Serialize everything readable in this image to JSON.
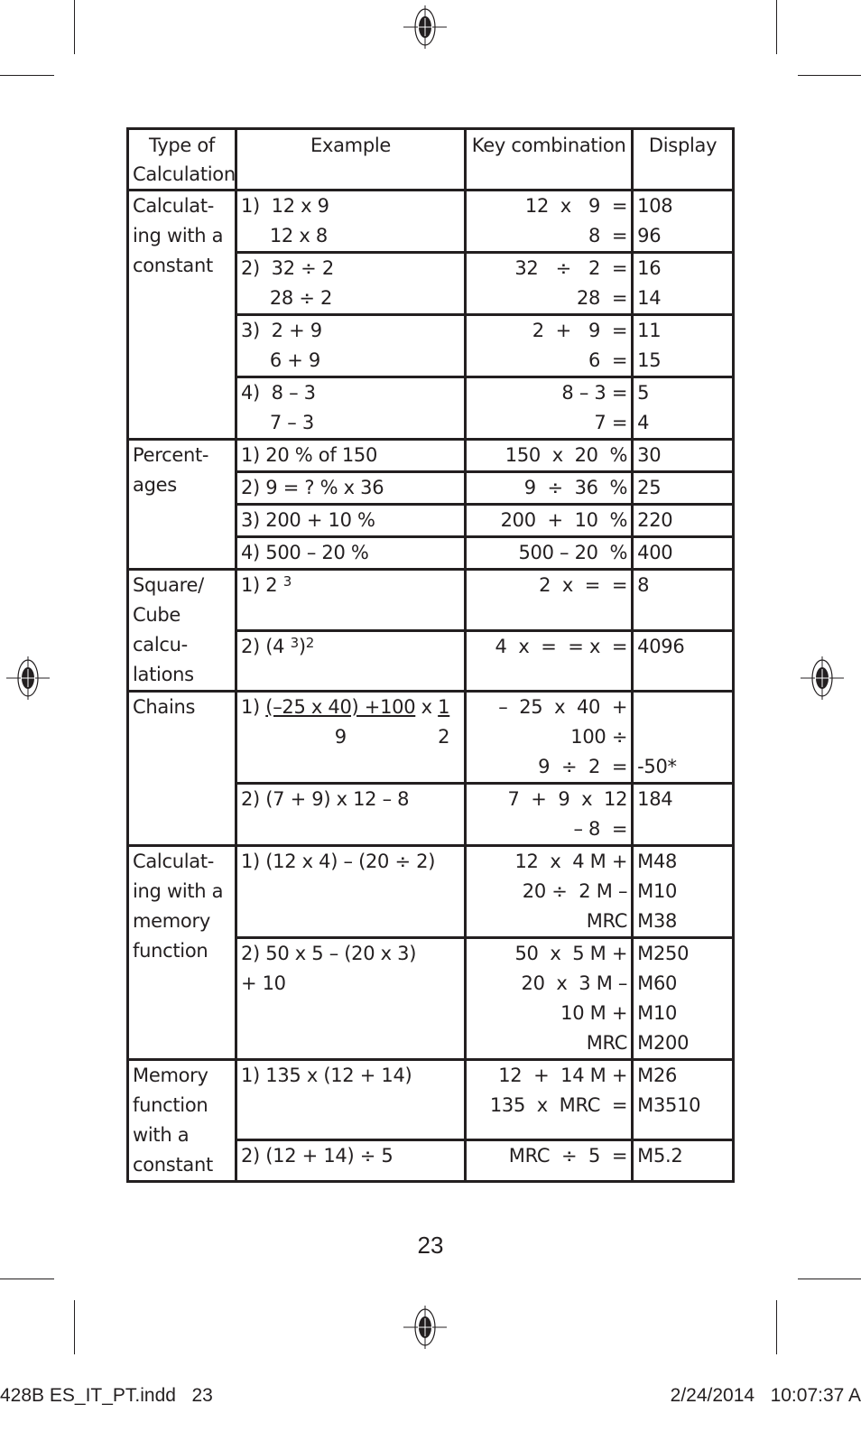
{
  "table": {
    "headers": {
      "type": "Type of Calculation",
      "example": "Example",
      "keys": "Key combination",
      "display": "Display"
    },
    "groups": [
      {
        "type": "Calculat-\ning with a\nconstant",
        "rows": [
          {
            "example": [
              "1)  12 x 9",
              "     12 x 8"
            ],
            "keys": [
              "12  x   9  =",
              "8  ="
            ],
            "display": [
              "108",
              "96"
            ]
          },
          {
            "example": [
              "2)  32 ÷ 2",
              "     28 ÷ 2"
            ],
            "keys": [
              "32   ÷   2  =",
              "28  ="
            ],
            "display": [
              "16",
              "14"
            ]
          },
          {
            "example": [
              "3)  2 + 9",
              "     6 + 9"
            ],
            "keys": [
              "2  +   9  =",
              "6  ="
            ],
            "display": [
              "11",
              "15"
            ]
          },
          {
            "example": [
              "4)  8 – 3",
              "     7 – 3"
            ],
            "keys": [
              "8 – 3 =",
              "7 ="
            ],
            "display": [
              "5",
              "4"
            ]
          }
        ]
      },
      {
        "type": "Percent-\nages",
        "rows": [
          {
            "example": [
              "1) 20 % of 150"
            ],
            "keys": [
              "150  x  20  %"
            ],
            "display": [
              "30"
            ]
          },
          {
            "example": [
              "2) 9 = ? % x 36"
            ],
            "keys": [
              "9  ÷  36  %"
            ],
            "display": [
              "25"
            ]
          },
          {
            "example": [
              "3) 200 + 10 %"
            ],
            "keys": [
              "200  +  10  %"
            ],
            "display": [
              "220"
            ]
          },
          {
            "example": [
              "4) 500 – 20 %"
            ],
            "keys": [
              "500 – 20  %"
            ],
            "display": [
              "400"
            ]
          }
        ]
      },
      {
        "type": "Square/\nCube calcu-\nlations",
        "rows": [
          {
            "example_base": "1) 2 ",
            "example_exp": "3",
            "keys": [
              "2  x  =  ="
            ],
            "display": [
              "8"
            ]
          },
          {
            "example_base": "2) (4 ",
            "example_exp": "3",
            "example_close": ")",
            "example_exp2": "2",
            "keys": [
              "4  x  =  = x  ="
            ],
            "display": [
              "4096"
            ]
          }
        ]
      },
      {
        "type": "Chains",
        "rows": [
          {
            "example_prefix": "1) ",
            "example_num": "(–25 x 40) +100",
            "example_den": "9",
            "example_mult": " x ",
            "example_num2": "1",
            "example_den2": "2",
            "keys": [
              "–  25  x  40  +",
              "100 ÷",
              "9  ÷  2  ="
            ],
            "display": [
              "",
              "",
              "-50*"
            ]
          },
          {
            "example": [
              "2) (7 + 9) x 12 – 8"
            ],
            "keys": [
              "7  +  9  x  12",
              "– 8  ="
            ],
            "display": [
              "184"
            ]
          }
        ]
      },
      {
        "type": "Calculat-\ning with a\nmemory\nfunction",
        "rows": [
          {
            "example": [
              "1) (12 x 4) – (20 ÷ 2)"
            ],
            "keys": [
              "12  x  4 M +",
              "20 ÷  2 M –",
              "MRC"
            ],
            "display": [
              "M48",
              "M10",
              "M38"
            ]
          },
          {
            "example": [
              "2) 50 x 5 – (20 x 3)",
              "+ 10"
            ],
            "keys": [
              "50  x  5 M +",
              "20  x  3 M –",
              "10 M +",
              "MRC"
            ],
            "display": [
              "M250",
              "M60",
              "M10",
              "M200"
            ]
          }
        ]
      },
      {
        "type": "Memory\nfunction\nwith a\nconstant",
        "rows": [
          {
            "example": [
              "1) 135 x (12 + 14)"
            ],
            "keys": [
              "12  +  14 M +",
              "135  x  MRC  ="
            ],
            "display": [
              "M26",
              "M3510"
            ]
          },
          {
            "example": [
              "2) (12 + 14) ÷ 5"
            ],
            "keys": [
              "MRC  ÷  5  ="
            ],
            "display": [
              "M5.2"
            ]
          }
        ]
      }
    ]
  },
  "page_number": "23",
  "slug": {
    "left": "428B ES_IT_PT.indd   23",
    "right": "2/24/2014   10:07:37 A"
  },
  "icons": {
    "registration_mark": "registration-target-icon"
  }
}
